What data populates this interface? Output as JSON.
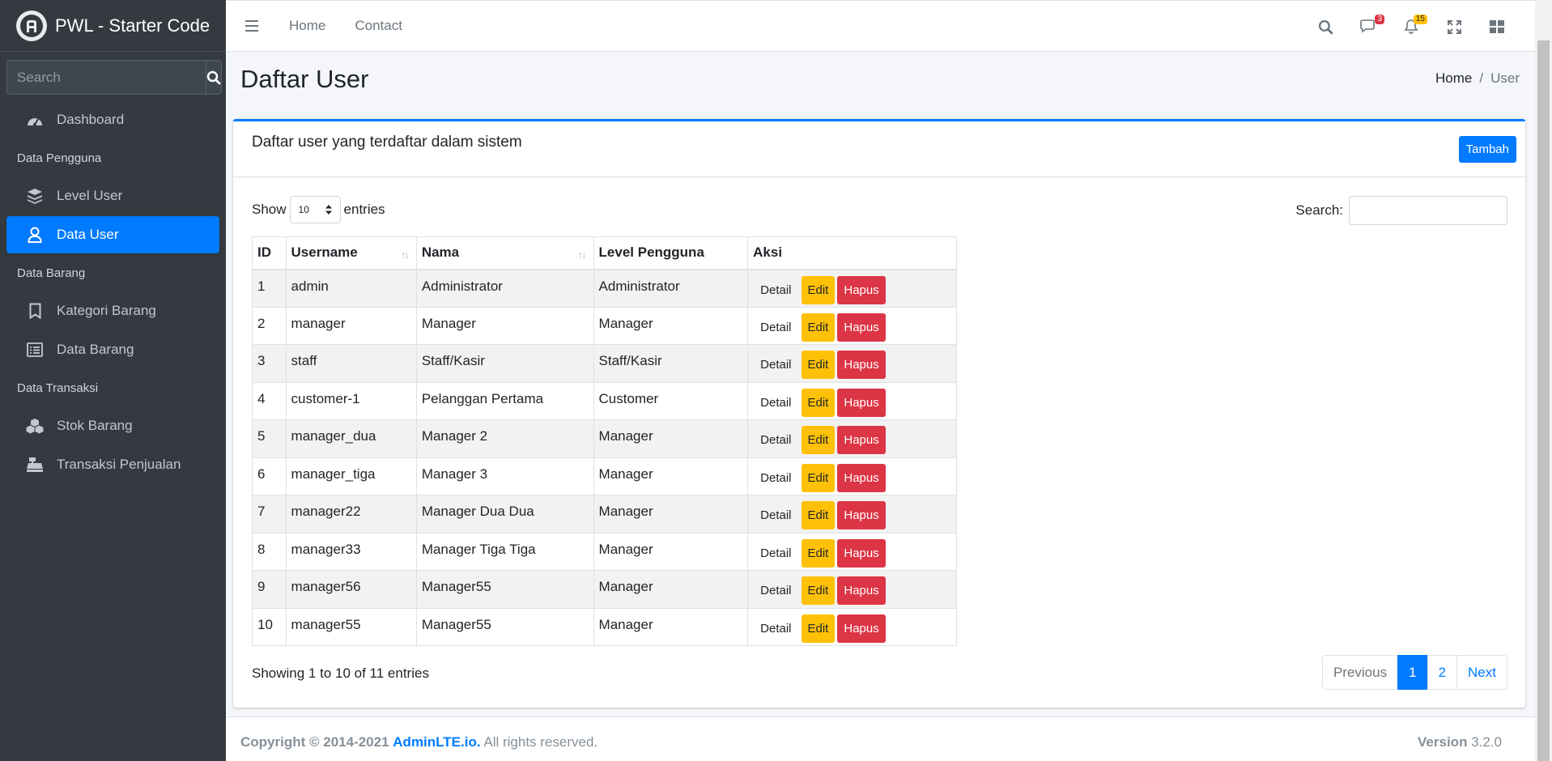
{
  "brand": {
    "title": "PWL - Starter Code"
  },
  "sidebar": {
    "search_placeholder": "Search",
    "items": [
      {
        "type": "item",
        "label": "Dashboard",
        "icon": "dashboard-icon",
        "active": false
      },
      {
        "type": "header",
        "label": "Data Pengguna"
      },
      {
        "type": "item",
        "label": "Level User",
        "icon": "layers-icon",
        "active": false
      },
      {
        "type": "item",
        "label": "Data User",
        "icon": "user-icon",
        "active": true
      },
      {
        "type": "header",
        "label": "Data Barang"
      },
      {
        "type": "item",
        "label": "Kategori Barang",
        "icon": "bookmark-icon",
        "active": false
      },
      {
        "type": "item",
        "label": "Data Barang",
        "icon": "list-icon",
        "active": false
      },
      {
        "type": "header",
        "label": "Data Transaksi"
      },
      {
        "type": "item",
        "label": "Stok Barang",
        "icon": "cubes-icon",
        "active": false
      },
      {
        "type": "item",
        "label": "Transaksi Penjualan",
        "icon": "cash-register-icon",
        "active": false
      }
    ]
  },
  "topbar": {
    "links": [
      "Home",
      "Contact"
    ],
    "messages_count": "3",
    "notifications_count": "15"
  },
  "page": {
    "title": "Daftar User",
    "breadcrumb": {
      "home": "Home",
      "current": "User",
      "separator": "/"
    }
  },
  "card": {
    "title": "Daftar user yang terdaftar dalam sistem",
    "add_button": "Tambah"
  },
  "table": {
    "show_label": "Show",
    "entries_label": "entries",
    "length_value": "10",
    "search_label": "Search:",
    "columns": [
      "ID",
      "Username",
      "Nama",
      "Level Pengguna",
      "Aksi"
    ],
    "action_labels": {
      "detail": "Detail",
      "edit": "Edit",
      "delete": "Hapus"
    },
    "rows": [
      [
        "1",
        "admin",
        "Administrator",
        "Administrator"
      ],
      [
        "2",
        "manager",
        "Manager",
        "Manager"
      ],
      [
        "3",
        "staff",
        "Staff/Kasir",
        "Staff/Kasir"
      ],
      [
        "4",
        "customer-1",
        "Pelanggan Pertama",
        "Customer"
      ],
      [
        "5",
        "manager_dua",
        "Manager 2",
        "Manager"
      ],
      [
        "6",
        "manager_tiga",
        "Manager 3",
        "Manager"
      ],
      [
        "7",
        "manager22",
        "Manager Dua Dua",
        "Manager"
      ],
      [
        "8",
        "manager33",
        "Manager Tiga Tiga",
        "Manager"
      ],
      [
        "9",
        "manager56",
        "Manager55",
        "Manager"
      ],
      [
        "10",
        "manager55",
        "Manager55",
        "Manager"
      ]
    ],
    "info": "Showing 1 to 10 of 11 entries",
    "pagination": {
      "previous": "Previous",
      "pages": [
        "1",
        "2"
      ],
      "active": "1",
      "next": "Next"
    }
  },
  "footer": {
    "copyright": "Copyright © 2014-2021",
    "link": "AdminLTE.io.",
    "rights": "All rights reserved.",
    "version_label": "Version",
    "version": "3.2.0"
  }
}
